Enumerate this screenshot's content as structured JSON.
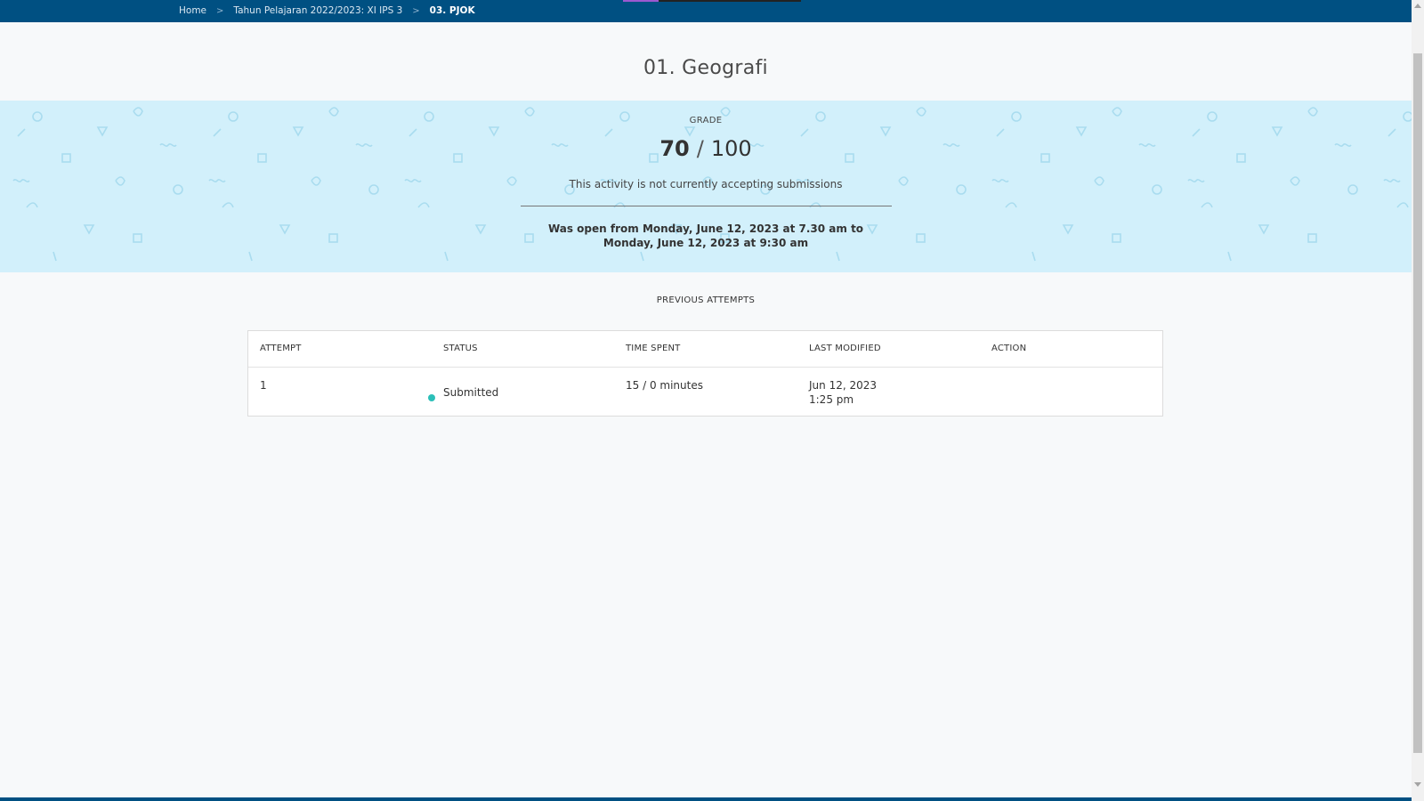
{
  "breadcrumb": {
    "items": [
      "Home",
      "Tahun Pelajaran 2022/2023: XI IPS 3",
      "03. PJOK"
    ],
    "separator": ">"
  },
  "page": {
    "title": "01. Geografi"
  },
  "grade": {
    "label": "GRADE",
    "earned": "70",
    "slash": "/",
    "total": "100",
    "status_message": "This activity is not currently accepting submissions",
    "open_window": "Was open from Monday, June 12, 2023 at 7.30 am to Monday, June 12, 2023 at 9:30 am"
  },
  "attempts": {
    "title": "PREVIOUS ATTEMPTS",
    "columns": [
      "ATTEMPT",
      "STATUS",
      "TIME SPENT",
      "LAST MODIFIED",
      "ACTION"
    ],
    "rows": [
      {
        "attempt": "1",
        "status": "Submitted",
        "status_color": "#2bbfb8",
        "time_spent": "15 / 0 minutes",
        "last_modified_date": "Jun 12, 2023",
        "last_modified_time": "1:25 pm",
        "action": ""
      }
    ]
  },
  "colors": {
    "topbar": "#005082",
    "banner": "#d2f0fb",
    "page_background": "#f7f9fa"
  }
}
